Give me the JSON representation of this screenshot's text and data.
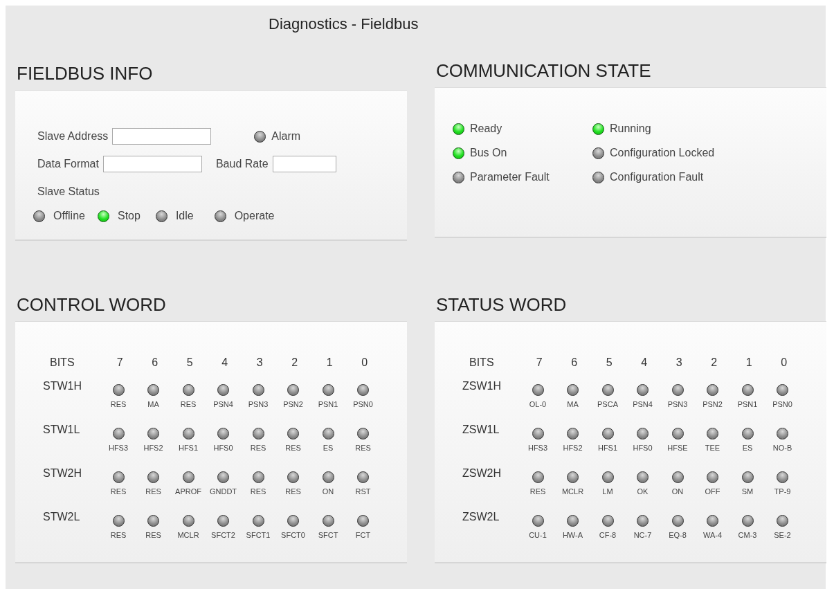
{
  "title": "Diagnostics - Fieldbus",
  "fieldbus_info": {
    "heading": "FIELDBUS INFO",
    "slave_address": {
      "label": "Slave Address"
    },
    "alarm": {
      "label": "Alarm",
      "on": false
    },
    "data_format": {
      "label": "Data Format"
    },
    "baud_rate": {
      "label": "Baud Rate"
    },
    "slave_status_label": "Slave Status",
    "slave_status": [
      {
        "label": "Offline",
        "on": false
      },
      {
        "label": "Stop",
        "on": true
      },
      {
        "label": "Idle",
        "on": false
      },
      {
        "label": "Operate",
        "on": false
      }
    ]
  },
  "communication_state": {
    "heading": "COMMUNICATION STATE",
    "leds": [
      {
        "label": "Ready",
        "on": true
      },
      {
        "label": "Running",
        "on": true
      },
      {
        "label": "Bus On",
        "on": true
      },
      {
        "label": "Configuration Locked",
        "on": false
      },
      {
        "label": "Parameter Fault",
        "on": false
      },
      {
        "label": "Configuration Fault",
        "on": false
      }
    ]
  },
  "words": [
    {
      "heading": "CONTROL WORD",
      "bits_label": "BITS",
      "bit_numbers": [
        "7",
        "6",
        "5",
        "4",
        "3",
        "2",
        "1",
        "0"
      ],
      "rows": [
        {
          "name": "STW1H",
          "bits": [
            {
              "label": "RES",
              "on": false
            },
            {
              "label": "MA",
              "on": false
            },
            {
              "label": "RES",
              "on": false
            },
            {
              "label": "PSN4",
              "on": false
            },
            {
              "label": "PSN3",
              "on": false
            },
            {
              "label": "PSN2",
              "on": false
            },
            {
              "label": "PSN1",
              "on": false
            },
            {
              "label": "PSN0",
              "on": false
            }
          ]
        },
        {
          "name": "STW1L",
          "bits": [
            {
              "label": "HFS3",
              "on": false
            },
            {
              "label": "HFS2",
              "on": false
            },
            {
              "label": "HFS1",
              "on": false
            },
            {
              "label": "HFS0",
              "on": false
            },
            {
              "label": "RES",
              "on": false
            },
            {
              "label": "RES",
              "on": false
            },
            {
              "label": "ES",
              "on": false
            },
            {
              "label": "RES",
              "on": false
            }
          ]
        },
        {
          "name": "STW2H",
          "bits": [
            {
              "label": "RES",
              "on": false
            },
            {
              "label": "RES",
              "on": false
            },
            {
              "label": "APROF",
              "on": false
            },
            {
              "label": "GNDDT",
              "on": false
            },
            {
              "label": "RES",
              "on": false
            },
            {
              "label": "RES",
              "on": false
            },
            {
              "label": "ON",
              "on": false
            },
            {
              "label": "RST",
              "on": false
            }
          ]
        },
        {
          "name": "STW2L",
          "bits": [
            {
              "label": "RES",
              "on": false
            },
            {
              "label": "RES",
              "on": false
            },
            {
              "label": "MCLR",
              "on": false
            },
            {
              "label": "SFCT2",
              "on": false
            },
            {
              "label": "SFCT1",
              "on": false
            },
            {
              "label": "SFCT0",
              "on": false
            },
            {
              "label": "SFCT",
              "on": false
            },
            {
              "label": "FCT",
              "on": false
            }
          ]
        }
      ]
    },
    {
      "heading": "STATUS WORD",
      "bits_label": "BITS",
      "bit_numbers": [
        "7",
        "6",
        "5",
        "4",
        "3",
        "2",
        "1",
        "0"
      ],
      "rows": [
        {
          "name": "ZSW1H",
          "bits": [
            {
              "label": "OL-0",
              "on": false
            },
            {
              "label": "MA",
              "on": false
            },
            {
              "label": "PSCA",
              "on": false
            },
            {
              "label": "PSN4",
              "on": false
            },
            {
              "label": "PSN3",
              "on": false
            },
            {
              "label": "PSN2",
              "on": false
            },
            {
              "label": "PSN1",
              "on": false
            },
            {
              "label": "PSN0",
              "on": false
            }
          ]
        },
        {
          "name": "ZSW1L",
          "bits": [
            {
              "label": "HFS3",
              "on": false
            },
            {
              "label": "HFS2",
              "on": false
            },
            {
              "label": "HFS1",
              "on": false
            },
            {
              "label": "HFS0",
              "on": false
            },
            {
              "label": "HFSE",
              "on": false
            },
            {
              "label": "TEE",
              "on": false
            },
            {
              "label": "ES",
              "on": false
            },
            {
              "label": "NO-B",
              "on": false
            }
          ]
        },
        {
          "name": "ZSW2H",
          "bits": [
            {
              "label": "RES",
              "on": false
            },
            {
              "label": "MCLR",
              "on": false
            },
            {
              "label": "LM",
              "on": false
            },
            {
              "label": "OK",
              "on": false
            },
            {
              "label": "ON",
              "on": false
            },
            {
              "label": "OFF",
              "on": false
            },
            {
              "label": "SM",
              "on": false
            },
            {
              "label": "TP-9",
              "on": false
            }
          ]
        },
        {
          "name": "ZSW2L",
          "bits": [
            {
              "label": "CU-1",
              "on": false
            },
            {
              "label": "HW-A",
              "on": false
            },
            {
              "label": "CF-8",
              "on": false
            },
            {
              "label": "NC-7",
              "on": false
            },
            {
              "label": "EQ-8",
              "on": false
            },
            {
              "label": "WA-4",
              "on": false
            },
            {
              "label": "CM-3",
              "on": false
            },
            {
              "label": "SE-2",
              "on": false
            }
          ]
        }
      ]
    }
  ]
}
